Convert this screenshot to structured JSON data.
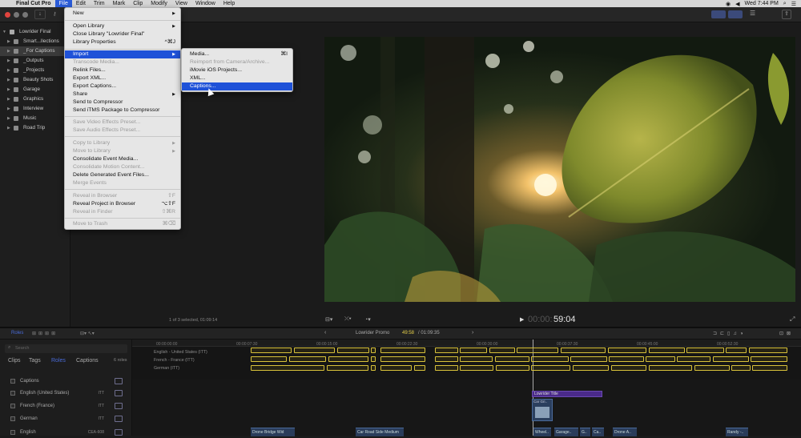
{
  "menubar": {
    "app": "Final Cut Pro",
    "items": [
      "File",
      "Edit",
      "Trim",
      "Mark",
      "Clip",
      "Modify",
      "View",
      "Window",
      "Help"
    ],
    "clock": "Wed 7:44 PM"
  },
  "library": {
    "items": [
      {
        "label": "Lowrider Final"
      },
      {
        "label": "Smart...llections"
      },
      {
        "label": "_For Captions"
      },
      {
        "label": "_Outputs"
      },
      {
        "label": "_Projects"
      },
      {
        "label": "Beauty Shots"
      },
      {
        "label": "Garage"
      },
      {
        "label": "Graphics"
      },
      {
        "label": "Interview"
      },
      {
        "label": "Music"
      },
      {
        "label": "Road Trip"
      }
    ]
  },
  "browser": {
    "status": "1 of 3 selected, 01:09:14"
  },
  "file_menu": {
    "items": [
      {
        "label": "New",
        "shortcut": "",
        "submenu": true,
        "disabled": false
      },
      {
        "label": "Open Library",
        "shortcut": "",
        "submenu": true,
        "disabled": false
      },
      {
        "label": "Close Library \"Lowrider Final\"",
        "shortcut": "",
        "submenu": false,
        "disabled": false
      },
      {
        "label": "Library Properties",
        "shortcut": "^⌘J",
        "submenu": false,
        "disabled": false
      },
      {
        "label": "Import",
        "shortcut": "",
        "submenu": true,
        "disabled": false,
        "selected": true
      },
      {
        "label": "Transcode Media...",
        "shortcut": "",
        "submenu": false,
        "disabled": true
      },
      {
        "label": "Relink Files...",
        "shortcut": "",
        "submenu": false,
        "disabled": false
      },
      {
        "label": "Export XML...",
        "shortcut": "",
        "submenu": false,
        "disabled": false
      },
      {
        "label": "Export Captions...",
        "shortcut": "",
        "submenu": false,
        "disabled": false
      },
      {
        "label": "Share",
        "shortcut": "",
        "submenu": true,
        "disabled": false
      },
      {
        "label": "Send to Compressor",
        "shortcut": "",
        "submenu": false,
        "disabled": false
      },
      {
        "label": "Send iTMS Package to Compressor",
        "shortcut": "",
        "submenu": false,
        "disabled": false
      },
      {
        "label": "Save Video Effects Preset...",
        "shortcut": "",
        "submenu": false,
        "disabled": true
      },
      {
        "label": "Save Audio Effects Preset...",
        "shortcut": "",
        "submenu": false,
        "disabled": true
      },
      {
        "label": "Copy to Library",
        "shortcut": "",
        "submenu": true,
        "disabled": true
      },
      {
        "label": "Move to Library",
        "shortcut": "",
        "submenu": true,
        "disabled": true
      },
      {
        "label": "Consolidate Event Media...",
        "shortcut": "",
        "submenu": false,
        "disabled": false
      },
      {
        "label": "Consolidate Motion Content...",
        "shortcut": "",
        "submenu": false,
        "disabled": true
      },
      {
        "label": "Delete Generated Event Files...",
        "shortcut": "",
        "submenu": false,
        "disabled": false
      },
      {
        "label": "Merge Events",
        "shortcut": "",
        "submenu": false,
        "disabled": true
      },
      {
        "label": "Reveal in Browser",
        "shortcut": "⇧F",
        "submenu": false,
        "disabled": true
      },
      {
        "label": "Reveal Project in Browser",
        "shortcut": "⌥⇧F",
        "submenu": false,
        "disabled": false
      },
      {
        "label": "Reveal in Finder",
        "shortcut": "⇧⌘R",
        "submenu": false,
        "disabled": true
      },
      {
        "label": "Move to Trash",
        "shortcut": "⌘⌫",
        "submenu": false,
        "disabled": true
      }
    ]
  },
  "import_menu": {
    "items": [
      {
        "label": "Media...",
        "shortcut": "⌘I",
        "disabled": false
      },
      {
        "label": "Reimport from Camera/Archive...",
        "shortcut": "",
        "disabled": true
      },
      {
        "label": "iMovie iOS Projects...",
        "shortcut": "",
        "disabled": false
      },
      {
        "label": "XML...",
        "shortcut": "",
        "disabled": false
      },
      {
        "label": "Captions...",
        "shortcut": "",
        "disabled": false,
        "selected": true
      }
    ]
  },
  "viewer": {
    "timecode_dim": "00:00:",
    "timecode": "59:04"
  },
  "timeline": {
    "project": "Lowrider Promo",
    "position": "49:58",
    "duration": "/ 01:09:35",
    "ruler": [
      "00:00:00:00",
      "00:00:07:30",
      "00:00:15:00",
      "00:00:22:30",
      "00:00:30:00",
      "00:00:37:30",
      "00:00:45:00",
      "00:00:52:30"
    ],
    "tracks": [
      "English - United States (ITT)",
      "French - France (ITT)",
      "German (ITT)"
    ],
    "title_clip": "Lowrider Title",
    "clips": [
      "Drone Bridge Wid",
      "Car Road Side Medium",
      "Wheel..",
      "Garage..",
      "G..",
      "Ca..",
      "Drone A..",
      "Randy -.."
    ],
    "small_clip": "Car Gri.."
  },
  "index": {
    "tab_roles": "Roles",
    "search_placeholder": "Search",
    "tabs": [
      "Clips",
      "Tags",
      "Roles",
      "Captions"
    ],
    "count": "6 roles",
    "roles": [
      {
        "name": "Captions",
        "tag": ""
      },
      {
        "name": "English (United States)",
        "tag": "ITT"
      },
      {
        "name": "French (France)",
        "tag": "ITT"
      },
      {
        "name": "German",
        "tag": "ITT"
      },
      {
        "name": "English",
        "tag": "CEA-608"
      }
    ]
  },
  "colors": {
    "accent": "#1f52d8",
    "caption": "#d8c23a",
    "title": "#5a2e9a"
  }
}
